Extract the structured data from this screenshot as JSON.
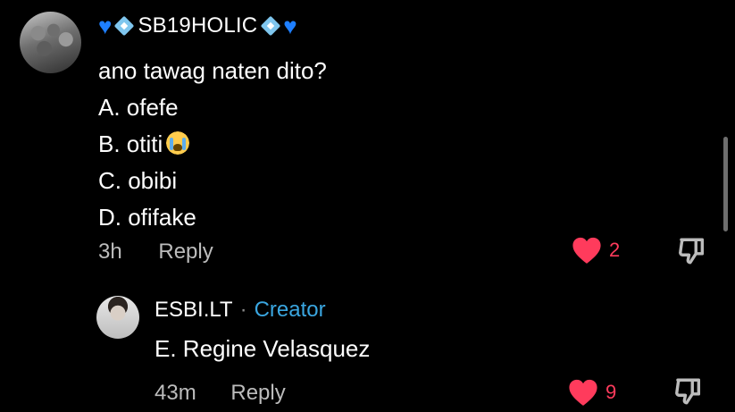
{
  "comment": {
    "username": "SB19HOLIC",
    "lines": [
      "ano tawag naten dito?",
      "A. ofefe",
      "B. otiti",
      "C. obibi",
      "D. ofifake"
    ],
    "time": "3h",
    "reply_label": "Reply",
    "likes": "2"
  },
  "reply": {
    "username": "ESBI.LT",
    "separator": "·",
    "badge": "Creator",
    "text": "E. Regine Velasquez",
    "time": "43m",
    "reply_label": "Reply",
    "likes": "9"
  },
  "colors": {
    "background": "#000000",
    "like_heart": "#ff3b5c",
    "creator_badge": "#3aa6e0",
    "username_heart": "#1e7fff"
  },
  "icons": {
    "username_decor": [
      "blue-heart-icon",
      "diamond-icon",
      "diamond-icon",
      "blue-heart-icon"
    ],
    "like": "heart-icon",
    "dislike": "thumbs-down-icon",
    "emoji_line_b": "crying-face-icon"
  }
}
